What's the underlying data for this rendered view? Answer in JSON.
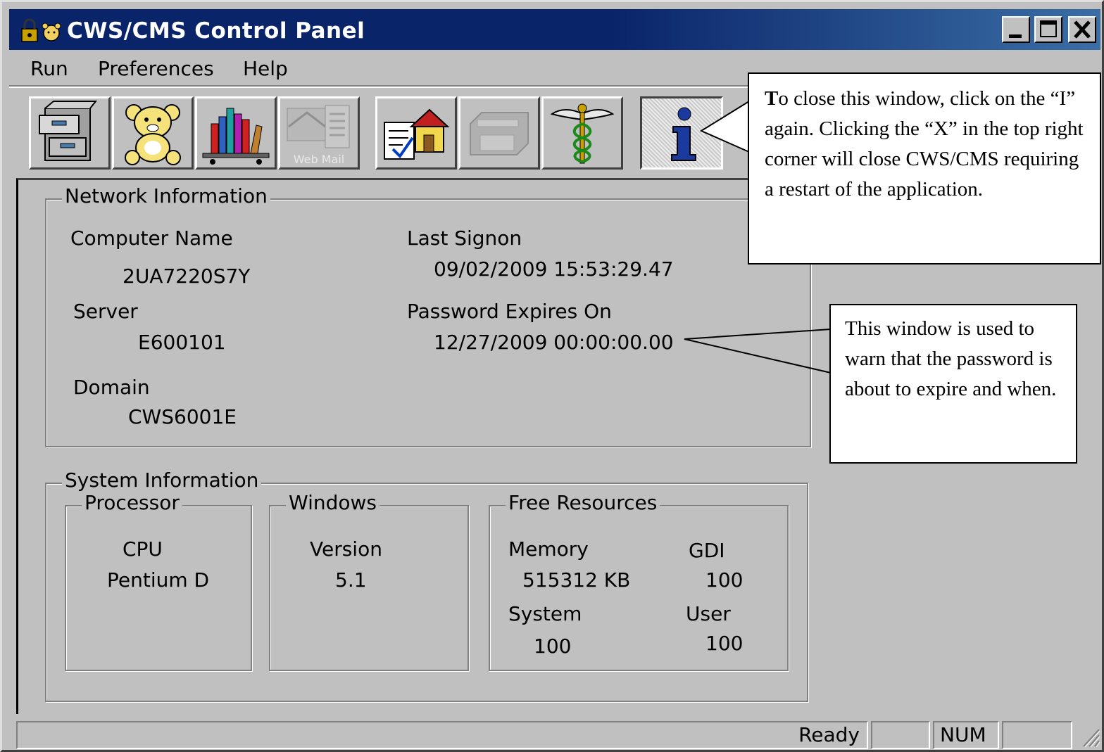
{
  "window": {
    "title": "CWS/CMS Control Panel"
  },
  "menubar": {
    "items": [
      "Run",
      "Preferences",
      "Help"
    ]
  },
  "toolbar": {
    "buttons": [
      {
        "icon": "file-cabinet-icon",
        "enabled": true
      },
      {
        "icon": "teddy-bear-icon",
        "enabled": true
      },
      {
        "icon": "bookshelf-icon",
        "enabled": true
      },
      {
        "icon": "web-mail-icon",
        "enabled": false,
        "caption": "Web Mail"
      },
      {
        "icon": "home-document-icon",
        "enabled": true
      },
      {
        "icon": "printer-icon",
        "enabled": false
      },
      {
        "icon": "caduceus-icon",
        "enabled": true
      },
      {
        "icon": "info-icon",
        "enabled": true,
        "pressed": true
      }
    ]
  },
  "network_info": {
    "title": "Network Information",
    "computer_name_label": "Computer Name",
    "computer_name": "2UA7220S7Y",
    "server_label": "Server",
    "server": "E600101",
    "domain_label": "Domain",
    "domain": "CWS6001E",
    "last_signon_label": "Last Signon",
    "last_signon": "09/02/2009 15:53:29.47",
    "password_expires_label": "Password Expires On",
    "password_expires": "12/27/2009 00:00:00.00"
  },
  "system_info": {
    "title": "System Information",
    "processor": {
      "title": "Processor",
      "cpu_label": "CPU",
      "cpu": "Pentium D"
    },
    "windows": {
      "title": "Windows",
      "version_label": "Version",
      "version": "5.1"
    },
    "free_resources": {
      "title": "Free Resources",
      "memory_label": "Memory",
      "memory": "515312 KB",
      "gdi_label": "GDI",
      "gdi": "100",
      "system_label": "System",
      "system": "100",
      "user_label": "User",
      "user": "100"
    }
  },
  "statusbar": {
    "status": "Ready",
    "num": "NUM"
  },
  "callouts": {
    "close_info_bold": "T",
    "close_info": "o close this window, click on the “I” again.  Clicking the “X” in the top right corner will close CWS/CMS requiring a restart of the application.",
    "password_warning": "This window is used to warn that the password is about to expire and when."
  },
  "colors": {
    "titlebar": "#0a246a",
    "face": "#c0c0c0"
  }
}
